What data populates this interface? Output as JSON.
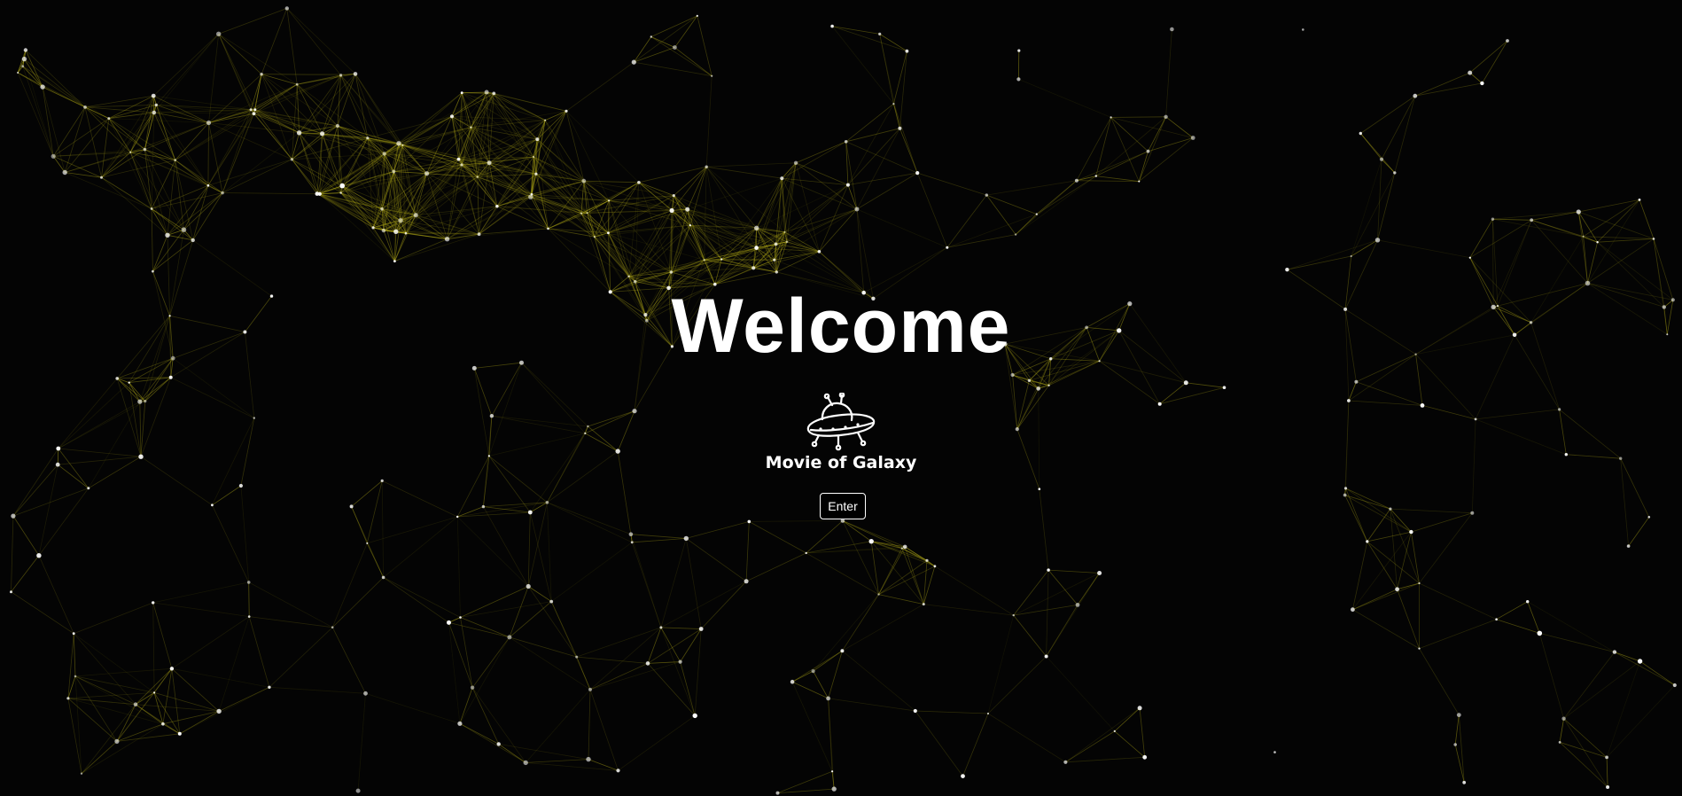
{
  "hero": {
    "title": "Welcome",
    "brand_name": "Movie of Galaxy",
    "enter_label": "Enter",
    "logo_icon": "ufo-icon"
  },
  "background": {
    "kind": "particle-network",
    "background_color": "#040404",
    "line_color": "#b5ad16",
    "node_color": "#ffffff"
  }
}
